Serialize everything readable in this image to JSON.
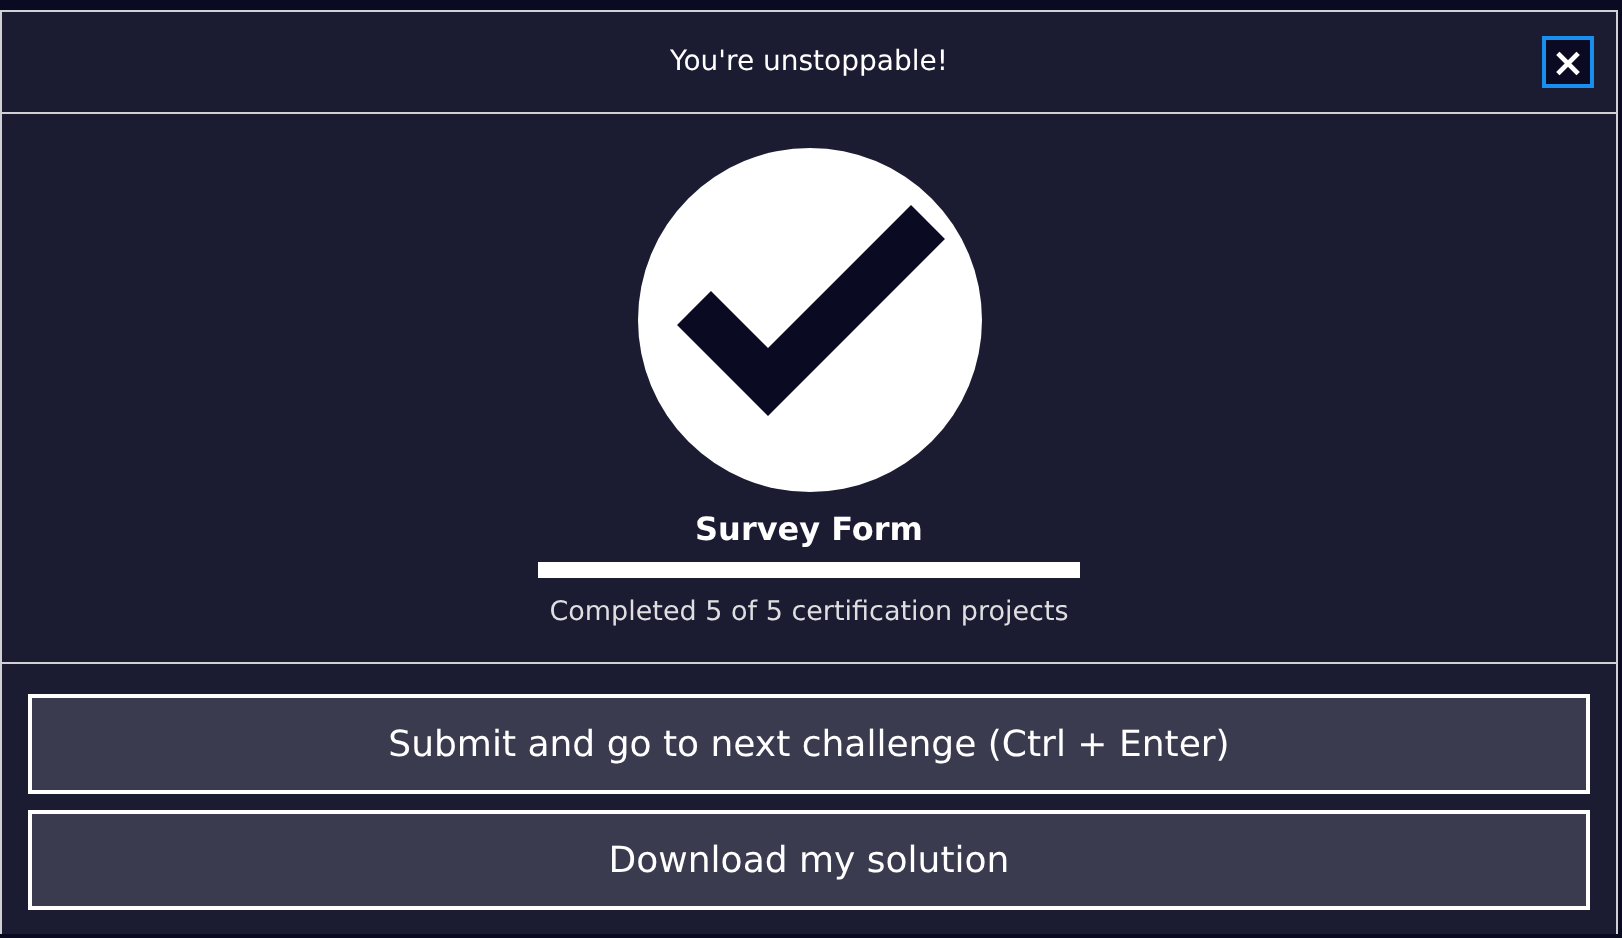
{
  "dialog": {
    "title": "You're unstoppable!",
    "close_label": "×"
  },
  "completion": {
    "project": "Survey Form",
    "level": 1,
    "caption": "Completed 5 of 5 certification projects"
  },
  "buttons": [
    {
      "label": "Submit and go to next challenge (Ctrl + Enter)"
    },
    {
      "label": "Download my solution"
    }
  ]
}
